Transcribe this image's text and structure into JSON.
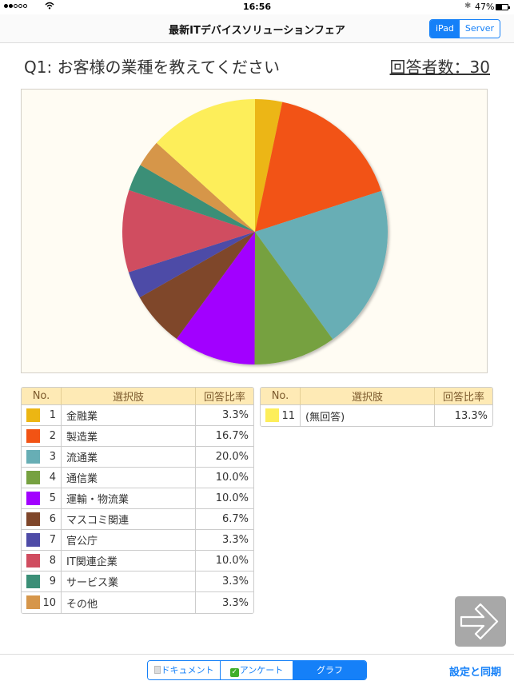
{
  "status_bar": {
    "signal_bars_filled": 2,
    "signal_bars_total": 5,
    "wifi_icon": "wifi-icon",
    "time": "16:56",
    "bluetooth_icon": "bluetooth-icon",
    "battery_percent": "47%"
  },
  "navbar": {
    "title": "最新ITデバイスソリューションフェア",
    "segments": [
      {
        "label": "iPad",
        "active": true
      },
      {
        "label": "Server",
        "active": false
      }
    ]
  },
  "question": {
    "text": "Q1: お客様の業種を教えてください",
    "respondents": "回答者数：30"
  },
  "table_headers": {
    "no": "No.",
    "choice": "選択肢",
    "ratio": "回答比率"
  },
  "chart_data": {
    "type": "pie",
    "title": "Q1: お客様の業種を教えてください",
    "total_respondents": 30,
    "start_angle": "12 o'clock, clockwise",
    "categories": [
      "金融業",
      "製造業",
      "流通業",
      "通信業",
      "運輸・物流業",
      "マスコミ関連",
      "官公庁",
      "IT関連企業",
      "サービス業",
      "その他",
      "(無回答)"
    ],
    "values": [
      3.3,
      16.7,
      20.0,
      10.0,
      10.0,
      6.7,
      3.3,
      10.0,
      3.3,
      3.3,
      13.3
    ],
    "colors": [
      "#ecb613",
      "#f25314",
      "#67aeb5",
      "#76a140",
      "#a200ff",
      "#7f462a",
      "#4e4ba7",
      "#d04d60",
      "#3b8f77",
      "#d6964a",
      "#fdee5a"
    ],
    "legend": "tables below chart"
  },
  "legend_rows": [
    {
      "no": "1",
      "label": "金融業",
      "ratio": "3.3%",
      "color": "#ecb613"
    },
    {
      "no": "2",
      "label": "製造業",
      "ratio": "16.7%",
      "color": "#f25314"
    },
    {
      "no": "3",
      "label": "流通業",
      "ratio": "20.0%",
      "color": "#67aeb5"
    },
    {
      "no": "4",
      "label": "通信業",
      "ratio": "10.0%",
      "color": "#76a140"
    },
    {
      "no": "5",
      "label": "運輸・物流業",
      "ratio": "10.0%",
      "color": "#a200ff"
    },
    {
      "no": "6",
      "label": "マスコミ関連",
      "ratio": "6.7%",
      "color": "#7f462a"
    },
    {
      "no": "7",
      "label": "官公庁",
      "ratio": "3.3%",
      "color": "#4e4ba7"
    },
    {
      "no": "8",
      "label": "IT関連企業",
      "ratio": "10.0%",
      "color": "#d04d60"
    },
    {
      "no": "9",
      "label": "サービス業",
      "ratio": "3.3%",
      "color": "#3b8f77"
    },
    {
      "no": "10",
      "label": "その他",
      "ratio": "3.3%",
      "color": "#d6964a"
    }
  ],
  "legend_rows_2": [
    {
      "no": "11",
      "label": "(無回答)",
      "ratio": "13.3%",
      "color": "#fdee5a"
    }
  ],
  "next_button": {
    "icon": "arrow-right-icon"
  },
  "tabbar": {
    "tabs": [
      {
        "label": "ドキュメント",
        "icon": "document-icon",
        "active": false
      },
      {
        "label": "アンケート",
        "icon": "checkbox-icon",
        "active": false
      },
      {
        "label": "グラフ",
        "active": true
      }
    ],
    "sync_label": "設定と同期"
  },
  "accent_color": "#1580f8"
}
